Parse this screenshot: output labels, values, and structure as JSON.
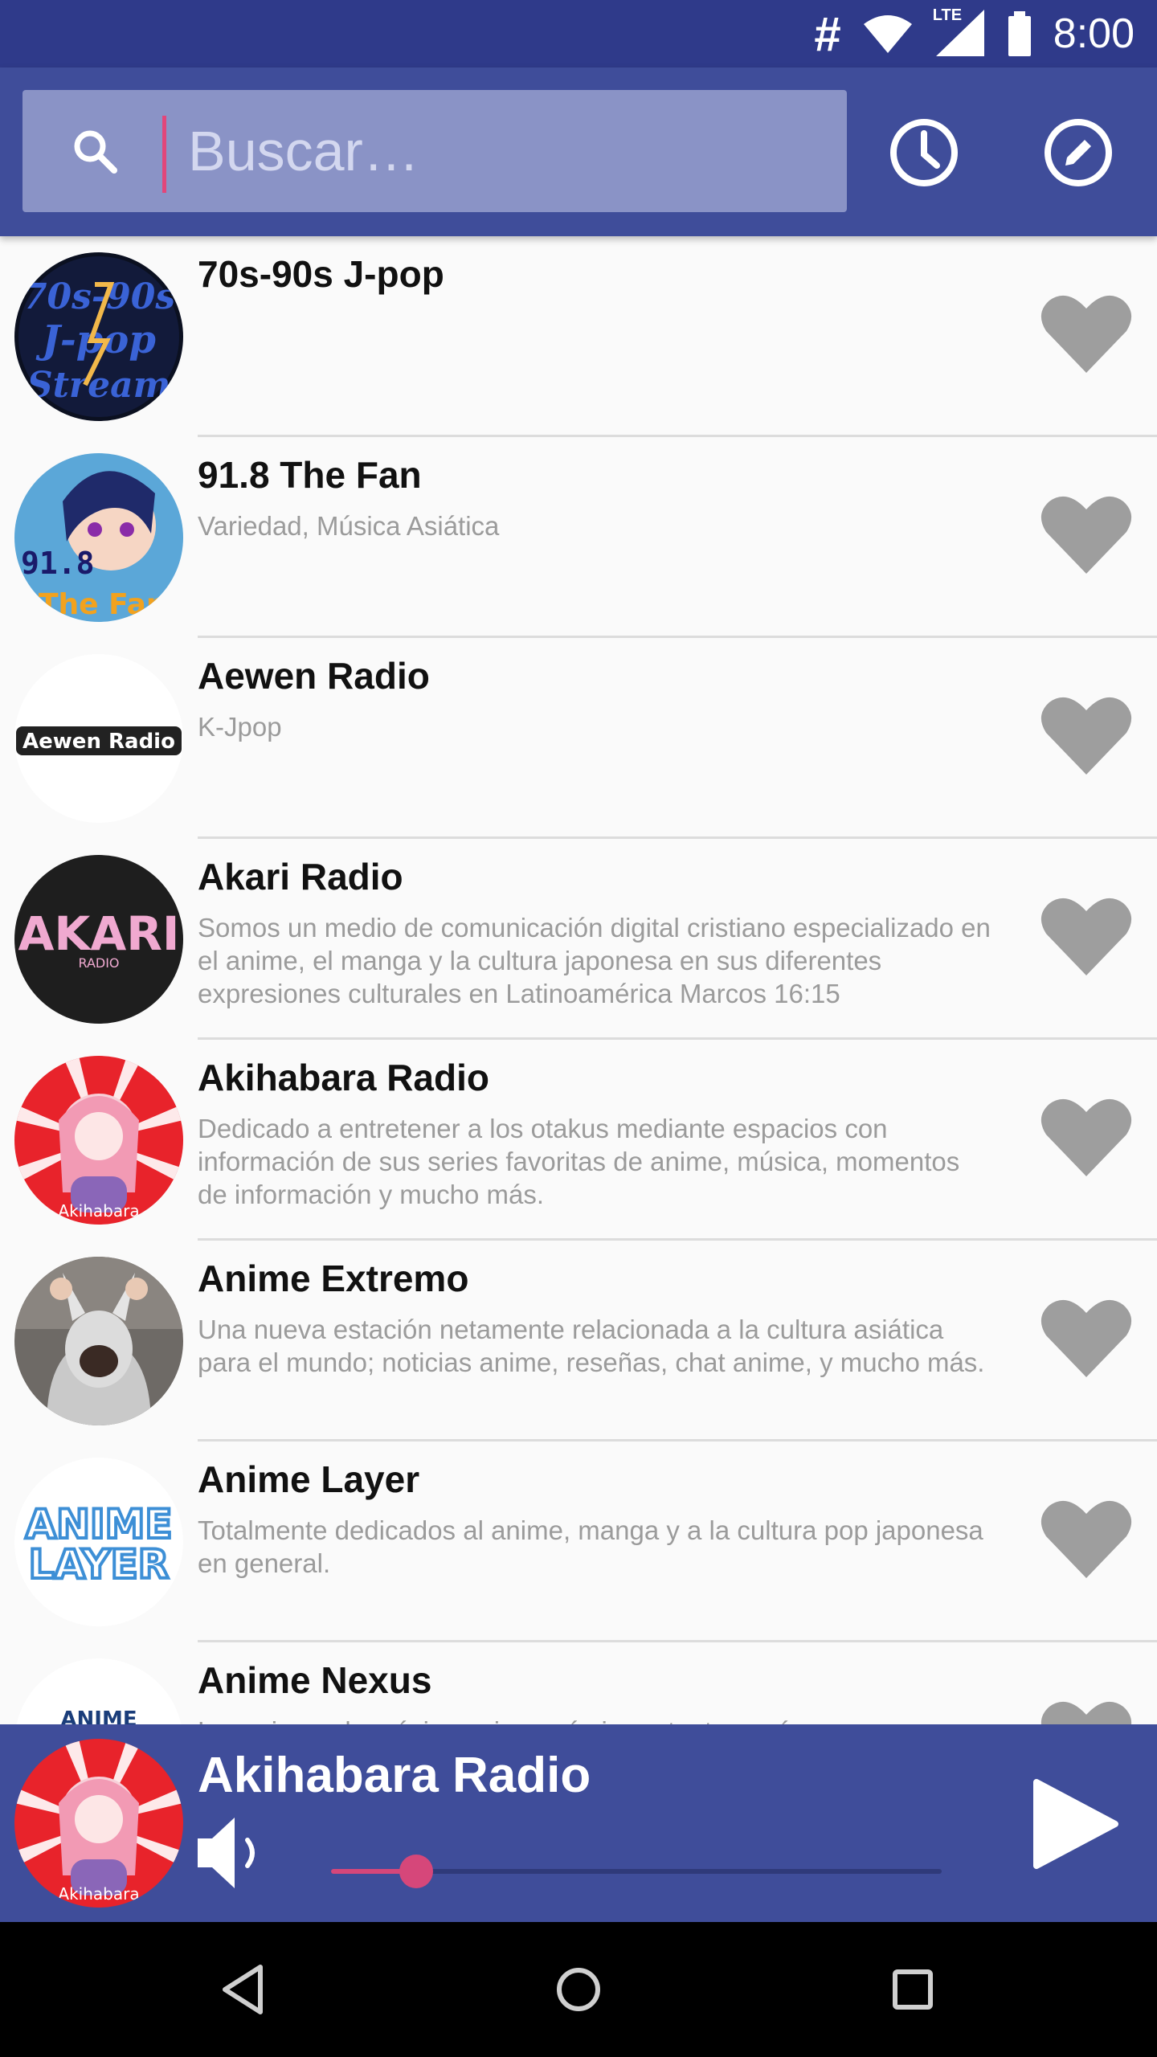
{
  "status_bar": {
    "time": "8:00",
    "hash": "#",
    "network": "LTE"
  },
  "search": {
    "placeholder": "Buscar…",
    "value": ""
  },
  "colors": {
    "primary": "#3f4d9a",
    "status_bar": "#2f3a8a",
    "accent": "#d6477a",
    "heart": "#9e9e9e"
  },
  "stations": [
    {
      "name": "70s-90s J-pop",
      "description": "",
      "logo_text": "70s-90s J-pop Stream"
    },
    {
      "name": "91.8 The Fan",
      "description": "Variedad, Música Asiática",
      "logo_text": "91.8 The Fan"
    },
    {
      "name": "Aewen Radio",
      "description": "K-Jpop",
      "logo_text": "Aewen Radio"
    },
    {
      "name": "Akari Radio",
      "description": "Somos un medio de comunicación digital cristiano especializado en el anime, el manga y la cultura japonesa en sus diferentes expresiones culturales en Latinoamérica Marcos 16:15",
      "logo_text": "AKARI RADIO"
    },
    {
      "name": "Akihabara Radio",
      "description": "Dedicado a entretener a los otakus mediante espacios con información de sus series favoritas de anime, música, momentos de información y mucho más.",
      "logo_text": "Akihabara"
    },
    {
      "name": "Anime Extremo",
      "description": "Una nueva estación netamente relacionada a la cultura asiática para el mundo; noticias anime, reseñas, chat anime, y mucho más.",
      "logo_text": ""
    },
    {
      "name": "Anime Layer",
      "description": "Totalmente dedicados al anime, manga y a la cultura pop japonesa en general.",
      "logo_text": "ANIME LAYER"
    },
    {
      "name": "Anime Nexus",
      "description": "La emisora de música anime más importante y más",
      "logo_text": "ANIME"
    }
  ],
  "player": {
    "title": "Akihabara Radio",
    "volume": 0.14,
    "logo_text": "Akihabara"
  }
}
